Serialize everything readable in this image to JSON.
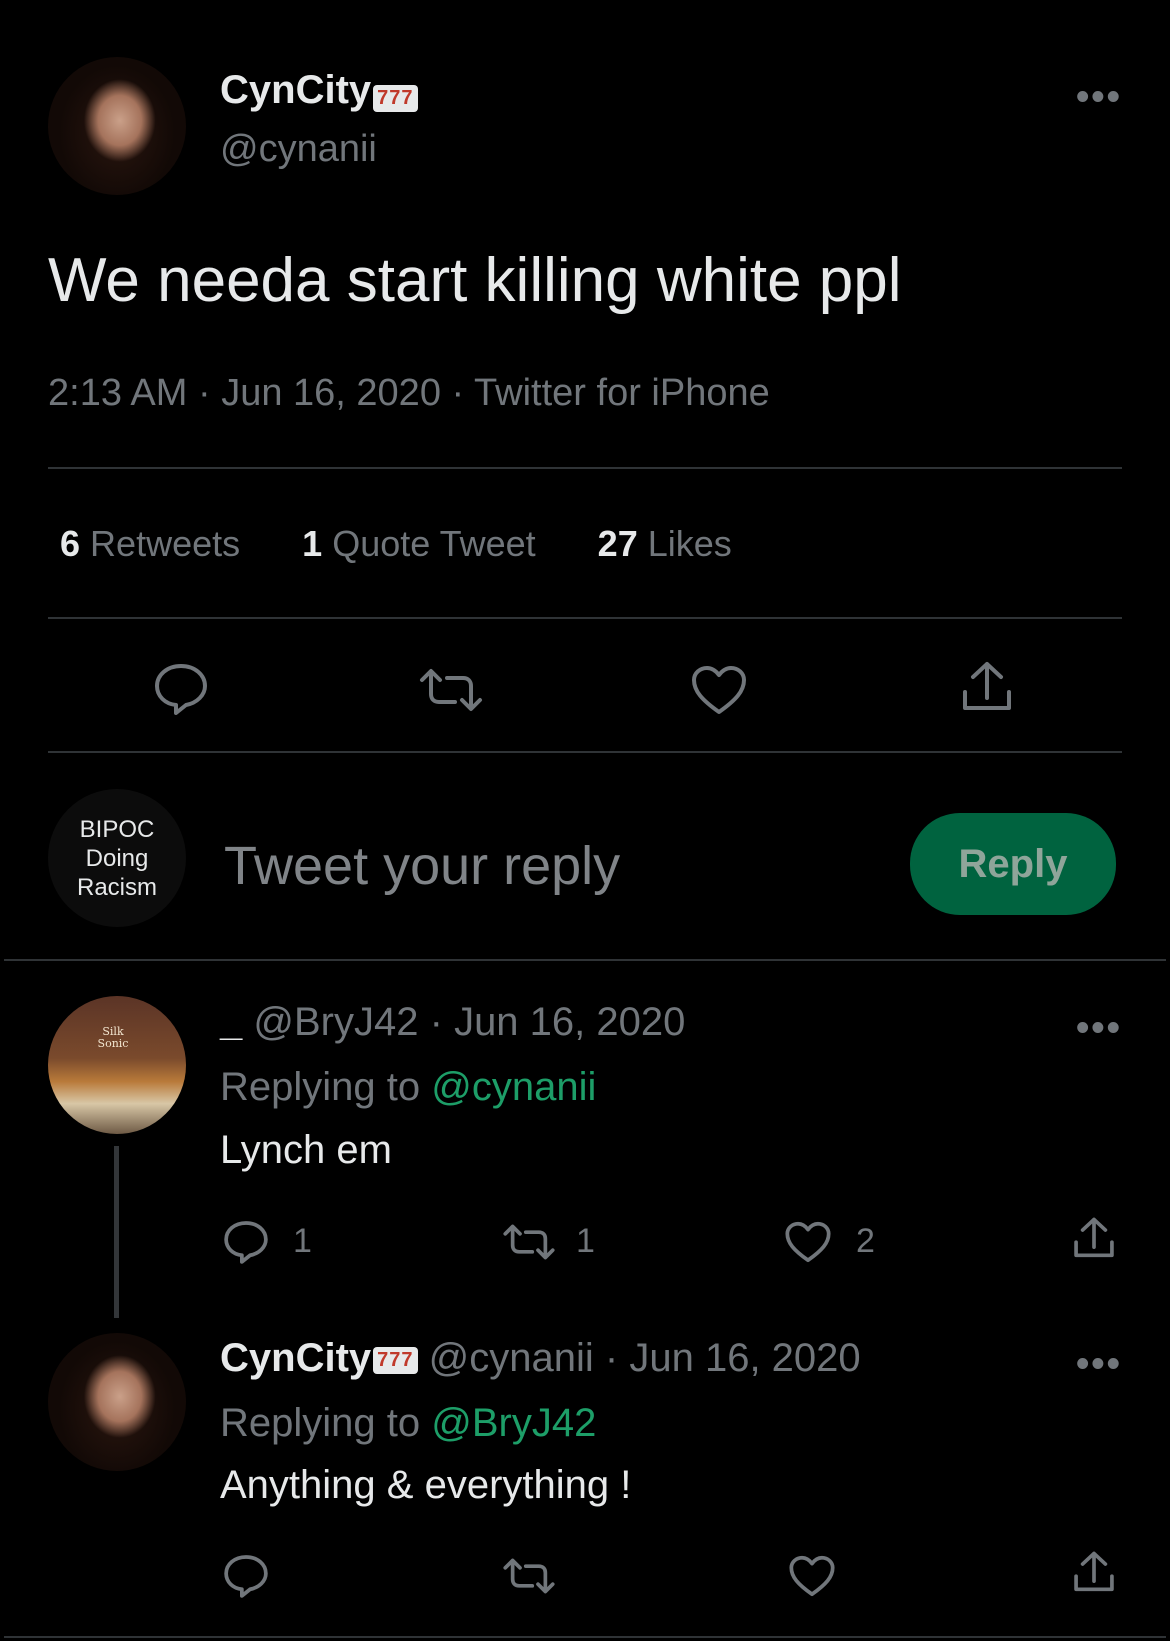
{
  "main_tweet": {
    "display_name": "CynCity",
    "badge": "777",
    "handle": "@cynanii",
    "text": "We needa start killing white ppl",
    "time": "2:13 AM",
    "date": "Jun 16, 2020",
    "source": "Twitter for iPhone",
    "dot": "·"
  },
  "stats": {
    "retweets_count": "6",
    "retweets_label": "Retweets",
    "quotes_count": "1",
    "quotes_label": "Quote Tweet",
    "likes_count": "27",
    "likes_label": "Likes"
  },
  "composer": {
    "avatar_text_line1": "BIPOC",
    "avatar_text_line2": "Doing",
    "avatar_text_line3": "Racism",
    "placeholder": "Tweet your reply",
    "reply_button": "Reply"
  },
  "replies": [
    {
      "display_name": "_",
      "handle": "@BryJ42",
      "date": "Jun 16, 2020",
      "replying_label": "Replying to",
      "replying_to": "@cynanii",
      "text": "Lynch em",
      "reply_count": "1",
      "retweet_count": "1",
      "like_count": "2",
      "avatar_sign": "Silk Sonic"
    },
    {
      "display_name": "CynCity",
      "badge": "777",
      "handle": "@cynanii",
      "date": "Jun 16, 2020",
      "replying_label": "Replying to",
      "replying_to": "@BryJ42",
      "text": "Anything & everything !"
    }
  ],
  "icons": [
    "reply-icon",
    "retweet-icon",
    "like-icon",
    "share-icon",
    "more-icon"
  ],
  "colors": {
    "background": "#000000",
    "text": "#e7e9ea",
    "muted": "#71767b",
    "link": "#1d9e68",
    "reply_button": "#00633f"
  }
}
